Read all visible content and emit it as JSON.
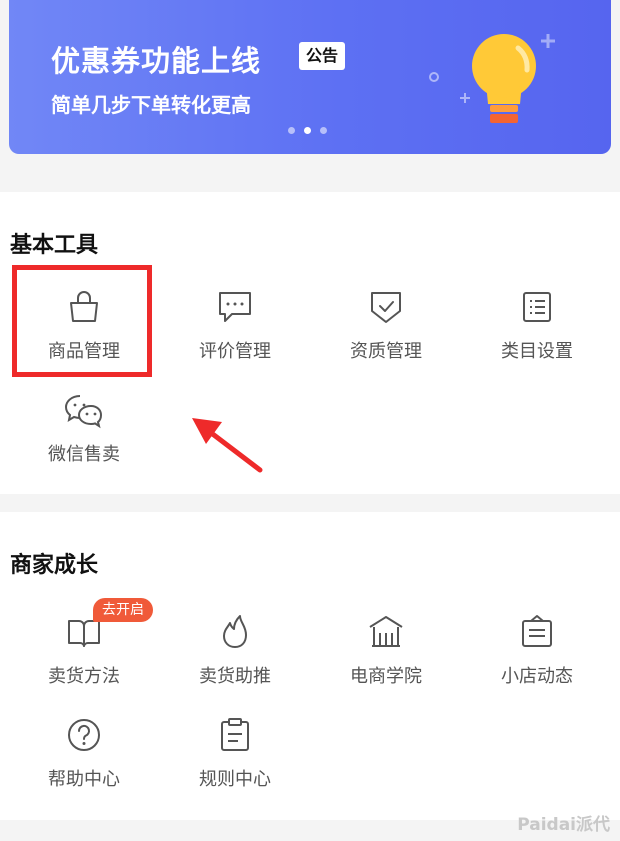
{
  "banner": {
    "title": "优惠券功能上线",
    "tag": "公告",
    "subtitle": "简单几步下单转化更高",
    "page_count": 3,
    "active_page": 2
  },
  "basic_tools": {
    "title": "基本工具",
    "items": [
      {
        "label": "商品管理",
        "icon": "shopping-bag-icon"
      },
      {
        "label": "评价管理",
        "icon": "comment-icon"
      },
      {
        "label": "资质管理",
        "icon": "shield-check-icon"
      },
      {
        "label": "类目设置",
        "icon": "list-icon"
      },
      {
        "label": "微信售卖",
        "icon": "wechat-icon"
      }
    ]
  },
  "merchant_growth": {
    "title": "商家成长",
    "items": [
      {
        "label": "卖货方法",
        "icon": "book-icon",
        "badge": "去开启"
      },
      {
        "label": "卖货助推",
        "icon": "flame-icon"
      },
      {
        "label": "电商学院",
        "icon": "school-icon"
      },
      {
        "label": "小店动态",
        "icon": "store-news-icon"
      },
      {
        "label": "帮助中心",
        "icon": "help-icon"
      },
      {
        "label": "规则中心",
        "icon": "clipboard-icon"
      }
    ]
  },
  "watermark": "Paidai派代",
  "colors": {
    "banner_start": "#7187f6",
    "banner_end": "#5665ef",
    "badge": "#f05a39",
    "highlight": "#ee2a2a",
    "arrow": "#ee2a2a"
  }
}
